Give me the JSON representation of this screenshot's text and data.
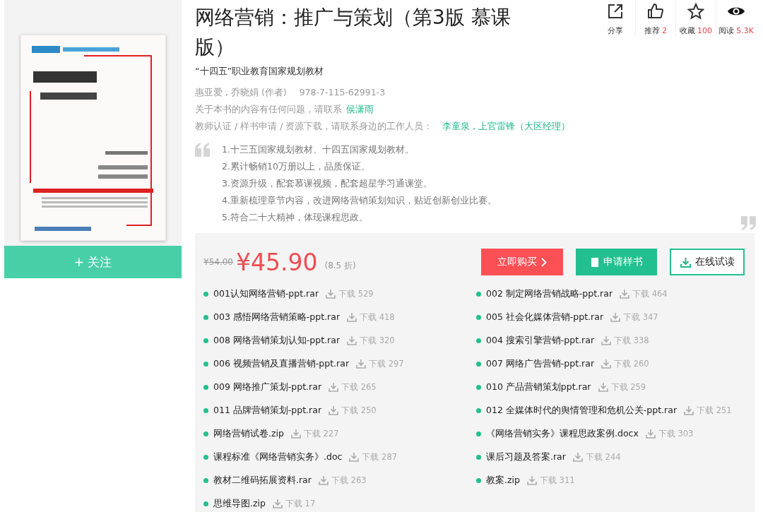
{
  "follow_button": {
    "icon": "+",
    "label": "关注"
  },
  "book": {
    "title": "网络营销：推广与策划（第3版 慕课版）",
    "series": "“十四五”职业教育国家规划教材",
    "authors": "惠亚爱 , 乔晓娟 (作者)",
    "isbn": "978-7-115-62991-3",
    "contact_text": "关于本书的内容有任何问题，请联系",
    "contact_name": "侯潇雨",
    "staff_text": "教师认证 / 样书申请 / 资源下载，请联系身边的工作人员：",
    "staff_names": "李童泉 , 上官雷锋（大区经理）"
  },
  "stats": [
    {
      "kind": "share",
      "label": "分享"
    },
    {
      "kind": "recommend",
      "label": "推荐",
      "count": "2"
    },
    {
      "kind": "favorite",
      "label": "收藏",
      "count": "100"
    },
    {
      "kind": "read",
      "label": "阅读",
      "count": "5.3K"
    }
  ],
  "highlights": [
    "1.十三五国家规划教材、十四五国家规划教材。",
    "2.累计畅销10万册以上，品质保证。",
    "3.资源升级，配套慕课视频，配套超星学习通课堂。",
    "4.重新梳理章节内容，改进网络营销策划知识，贴近创新创业比赛。",
    "5.符合二十大精神，体现课程思政。"
  ],
  "price": {
    "original": "¥54.00",
    "current": "¥45.90",
    "discount": "(8.5 折)"
  },
  "buttons": [
    {
      "kind": "buy",
      "label": "立即购买"
    },
    {
      "kind": "sample",
      "label": "申请样书"
    },
    {
      "kind": "read",
      "label": "在线试读"
    }
  ],
  "files": [
    {
      "name": "001认知网络营销-ppt.rar",
      "downloads": "下载 529"
    },
    {
      "name": "002 制定网络营销战略-ppt.rar",
      "downloads": "下载 464"
    },
    {
      "name": "003 感悟网络营销策略-ppt.rar",
      "downloads": "下载 418"
    },
    {
      "name": "005 社会化媒体营销-ppt.rar",
      "downloads": "下载 347"
    },
    {
      "name": "008 网络营销策划认知-ppt.rar",
      "downloads": "下载 320"
    },
    {
      "name": "004 搜索引擎营销-ppt.rar",
      "downloads": "下载 338"
    },
    {
      "name": "006 视频营销及直播营销-ppt.rar",
      "downloads": "下载 297"
    },
    {
      "name": "007 网络广告营销-ppt.rar",
      "downloads": "下载 260"
    },
    {
      "name": "009 网络推广策划-ppt.rar",
      "downloads": "下载 265"
    },
    {
      "name": "010 产品营销策划ppt.rar",
      "downloads": "下载 259"
    },
    {
      "name": "011 品牌营销策划-ppt.rar",
      "downloads": "下载 250"
    },
    {
      "name": "012 全媒体时代的舆情管理和危机公关-ppt.rar",
      "downloads": "下载 251"
    },
    {
      "name": "网络营销试卷.zip",
      "downloads": "下载 227"
    },
    {
      "name": "《网络营销实务》课程思政案例.docx",
      "downloads": "下载 303"
    },
    {
      "name": "课程标准《网络营销实务》.doc",
      "downloads": "下载 287"
    },
    {
      "name": "课后习题及答案.rar",
      "downloads": "下载 244"
    },
    {
      "name": "教材二维码拓展资料.rar",
      "downloads": "下载 263"
    },
    {
      "name": "教案.zip",
      "downloads": "下载 311"
    },
    {
      "name": "思维导图.zip",
      "downloads": "下载 17"
    }
  ]
}
